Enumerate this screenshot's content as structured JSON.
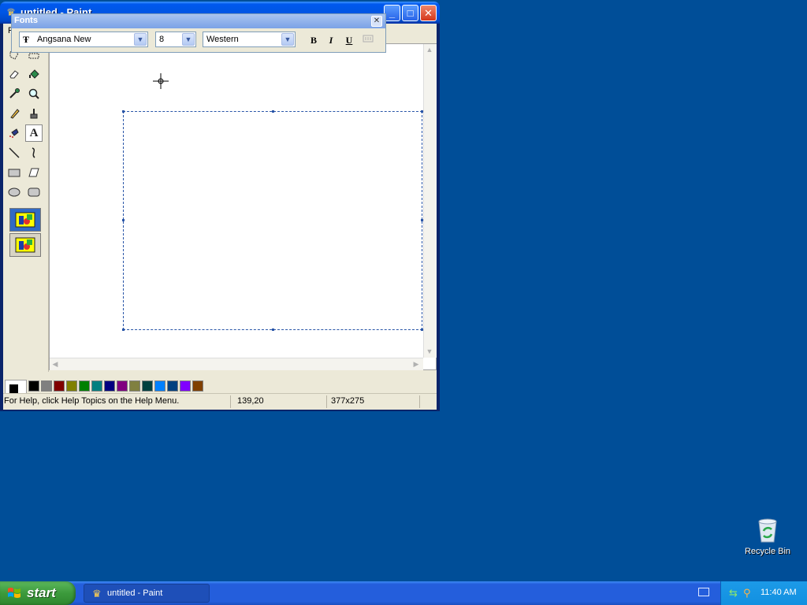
{
  "window": {
    "title": "untitled - Paint",
    "menu": {
      "file_label": "F"
    }
  },
  "fonts_toolbar": {
    "title": "Fonts",
    "close_glyph": "✕",
    "font_name": "Angsana New",
    "font_size": "8",
    "script": "Western",
    "bold_label": "B",
    "italic_label": "I",
    "underline_label": "U"
  },
  "tools": [
    "free-form-select",
    "select",
    "eraser",
    "fill-with-color",
    "pick-color",
    "magnifier",
    "pencil",
    "brush",
    "airbrush",
    "text",
    "line",
    "curve",
    "rectangle",
    "polygon",
    "ellipse",
    "rounded-rectangle"
  ],
  "active_tool": "text",
  "palette": {
    "foreground": "#000000",
    "background": "#ffffff",
    "top_row": [
      "#000000",
      "#808080",
      "#800000",
      "#808000",
      "#008000",
      "#008080",
      "#000080",
      "#800080",
      "#808040",
      "#004040",
      "#0080ff",
      "#004080",
      "#8000ff",
      "#804000"
    ],
    "bottom_row": [
      "#ffffff",
      "#c0c0c0",
      "#ff0000",
      "#ffff00",
      "#00ff00",
      "#00ffff",
      "#0000ff",
      "#ff00ff",
      "#ffff80",
      "#00ff80",
      "#80ffff",
      "#8080ff",
      "#ff0080",
      "#ff8040"
    ]
  },
  "status": {
    "help": "For Help, click Help Topics on the Help Menu.",
    "coords": "139,20",
    "size": "377x275"
  },
  "desktop": {
    "recycle_bin_label": "Recycle Bin"
  },
  "taskbar": {
    "start_label": "start",
    "task_label": "untitled - Paint",
    "clock": "11:40 AM"
  }
}
